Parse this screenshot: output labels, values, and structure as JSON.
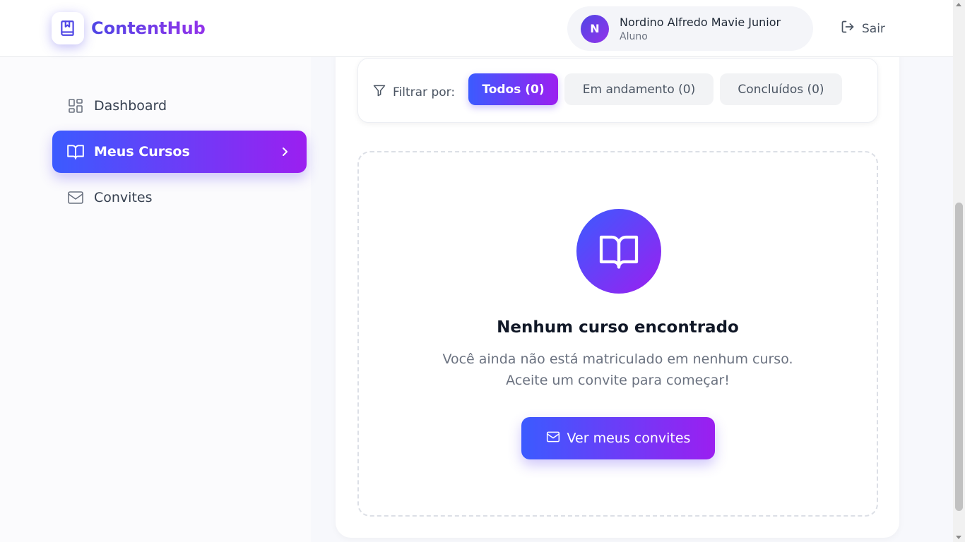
{
  "brand": {
    "name": "ContentHub",
    "logo_icon": "bookmark-book-icon"
  },
  "user": {
    "initial": "N",
    "name": "Nordino Alfredo Mavie Junior",
    "role": "Aluno"
  },
  "logout": {
    "label": "Sair",
    "icon": "logout-icon"
  },
  "sidebar": {
    "items": [
      {
        "label": "Dashboard",
        "icon": "grid-icon",
        "active": false
      },
      {
        "label": "Meus Cursos",
        "icon": "book-open-icon",
        "active": true
      },
      {
        "label": "Convites",
        "icon": "mail-icon",
        "active": false
      }
    ]
  },
  "filter": {
    "label": "Filtrar por:",
    "options": [
      {
        "label": "Todos (0)",
        "active": true
      },
      {
        "label": "Em andamento (0)",
        "active": false
      },
      {
        "label": "Concluídos (0)",
        "active": false
      }
    ]
  },
  "empty_state": {
    "title": "Nenhum curso encontrado",
    "line1": "Você ainda não está matriculado em nenhum curso.",
    "line2": "Aceite um convite para começar!",
    "button_label": "Ver meus convites"
  },
  "colors": {
    "accent_start": "#3b5bff",
    "accent_end": "#9b1ff0"
  }
}
